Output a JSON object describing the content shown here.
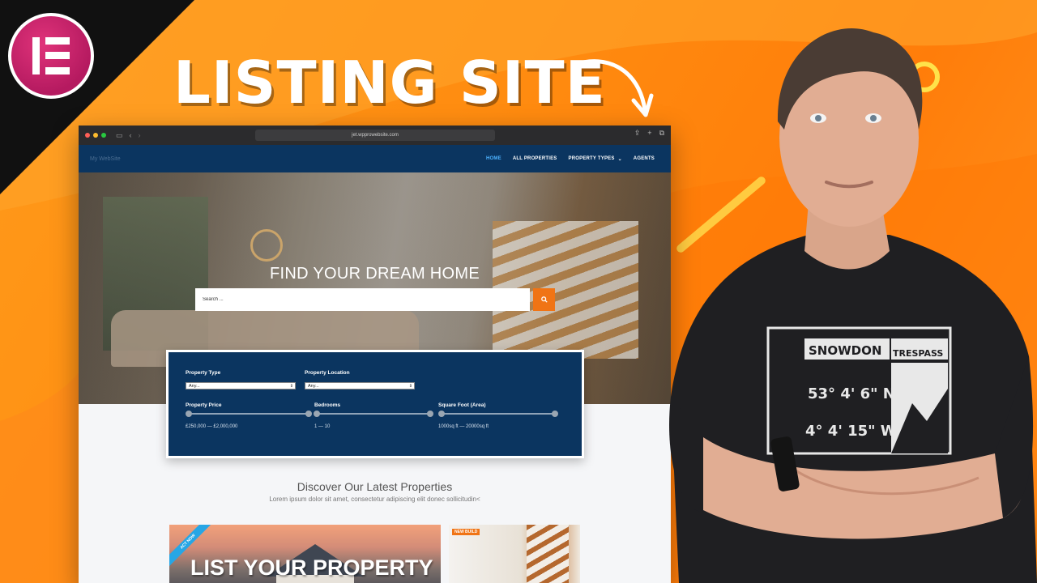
{
  "thumbnail": {
    "headline": "LISTING SITE"
  },
  "browser": {
    "url": "jet.wpprowebsite.com"
  },
  "site": {
    "name": "My WebSite",
    "nav": [
      {
        "label": "HOME",
        "active": true
      },
      {
        "label": "ALL PROPERTIES",
        "active": false
      },
      {
        "label": "PROPERTY TYPES",
        "active": false,
        "has_dropdown": true
      },
      {
        "label": "AGENTS",
        "active": false
      }
    ],
    "hero": {
      "title": "FIND YOUR DREAM HOME",
      "search_placeholder": "Search ...",
      "search_icon": "search-icon"
    },
    "filters": {
      "property_type": {
        "label": "Property Type",
        "value": "Any..."
      },
      "property_location": {
        "label": "Property Location",
        "value": "Any..."
      },
      "price": {
        "label": "Property Price",
        "range": "£250,000 — £2,000,000"
      },
      "bedrooms": {
        "label": "Bedrooms",
        "range": "1 — 10"
      },
      "area": {
        "label": "Square Foot (Area)",
        "range": "1000sq ft — 20000sq ft"
      }
    },
    "latest": {
      "title": "Discover Our Latest Properties",
      "subtitle": "Lorem ipsum dolor sit amet, consectetur adipiscing elit donec sollicitudin<"
    },
    "cards": {
      "main_title": "LIST YOUR PROPERTY",
      "main_ribbon": "ACT NOW",
      "side_badge": "NEW BUILD"
    }
  },
  "presenter_shirt": {
    "brand": "TRESPASS",
    "mountain": "SNOWDON",
    "lat": "53° 4' 6\" N",
    "lon": "4° 4' 15\" W"
  },
  "colors": {
    "background": "#ff8c10",
    "nav": "#0b3560",
    "accent": "#f07415",
    "active_link": "#4db3ff"
  }
}
